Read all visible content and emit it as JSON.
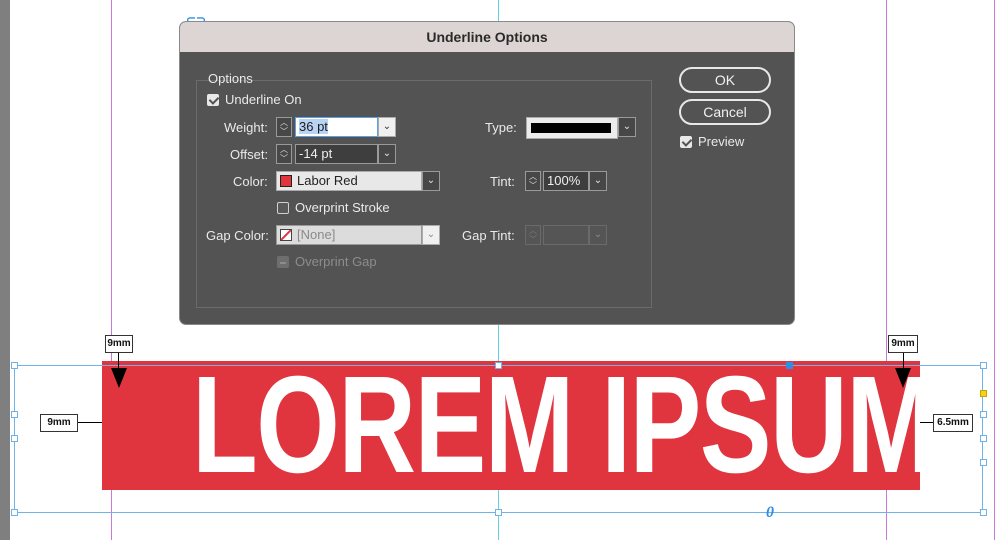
{
  "dialog": {
    "title": "Underline Options",
    "group_label": "Options",
    "underline_on": {
      "label": "Underline On",
      "checked": true
    },
    "weight": {
      "label": "Weight:",
      "value": "36 pt"
    },
    "offset": {
      "label": "Offset:",
      "value": "-14 pt"
    },
    "color": {
      "label": "Color:",
      "value": "Labor Red",
      "swatch": "#e0353f"
    },
    "overprint_stroke": {
      "label": "Overprint Stroke",
      "checked": false
    },
    "gap_color": {
      "label": "Gap Color:",
      "value": "[None]"
    },
    "overprint_gap": {
      "label": "Overprint Gap",
      "enabled": false
    },
    "type": {
      "label": "Type:"
    },
    "tint": {
      "label": "Tint:",
      "value": "100%"
    },
    "gap_tint": {
      "label": "Gap Tint:",
      "value": ""
    },
    "ok_label": "OK",
    "cancel_label": "Cancel",
    "preview": {
      "label": "Preview",
      "checked": true
    }
  },
  "canvas": {
    "banner_text": "LOREM IPSUM",
    "banner_color": "#e0353f",
    "dims": {
      "top_left": "9mm",
      "left": "9mm",
      "top_right": "9mm",
      "right": "6.5mm"
    },
    "zero_mark": "0"
  },
  "icons": [
    "link-icon",
    "stepper-icon",
    "chevron-down-icon",
    "checkbox-icon"
  ]
}
